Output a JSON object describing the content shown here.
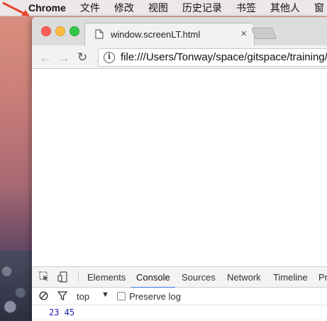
{
  "menubar": {
    "app_name": "Chrome",
    "items": [
      "文件",
      "修改",
      "视图",
      "历史记录",
      "书签",
      "其他人",
      "窗"
    ]
  },
  "browser": {
    "tab_title": "window.screenLT.html",
    "tab_close": "×",
    "address": "file:///Users/Tonway/space/gitspace/training/ja",
    "info_glyph": "i",
    "back_glyph": "←",
    "forward_glyph": "→",
    "reload_glyph": "↻"
  },
  "devtools": {
    "tabs": [
      "Elements",
      "Console",
      "Sources",
      "Network",
      "Timeline",
      "Pr"
    ],
    "active_tab": "Console",
    "context": "top",
    "context_caret": "▼",
    "preserve_log_label": "Preserve log",
    "preserve_log_checked": false,
    "console_output": "23 45",
    "prompt": ">"
  },
  "colors": {
    "accent": "#3879d9",
    "console_output": "#1a1aa6",
    "arrow": "#e8452c"
  }
}
